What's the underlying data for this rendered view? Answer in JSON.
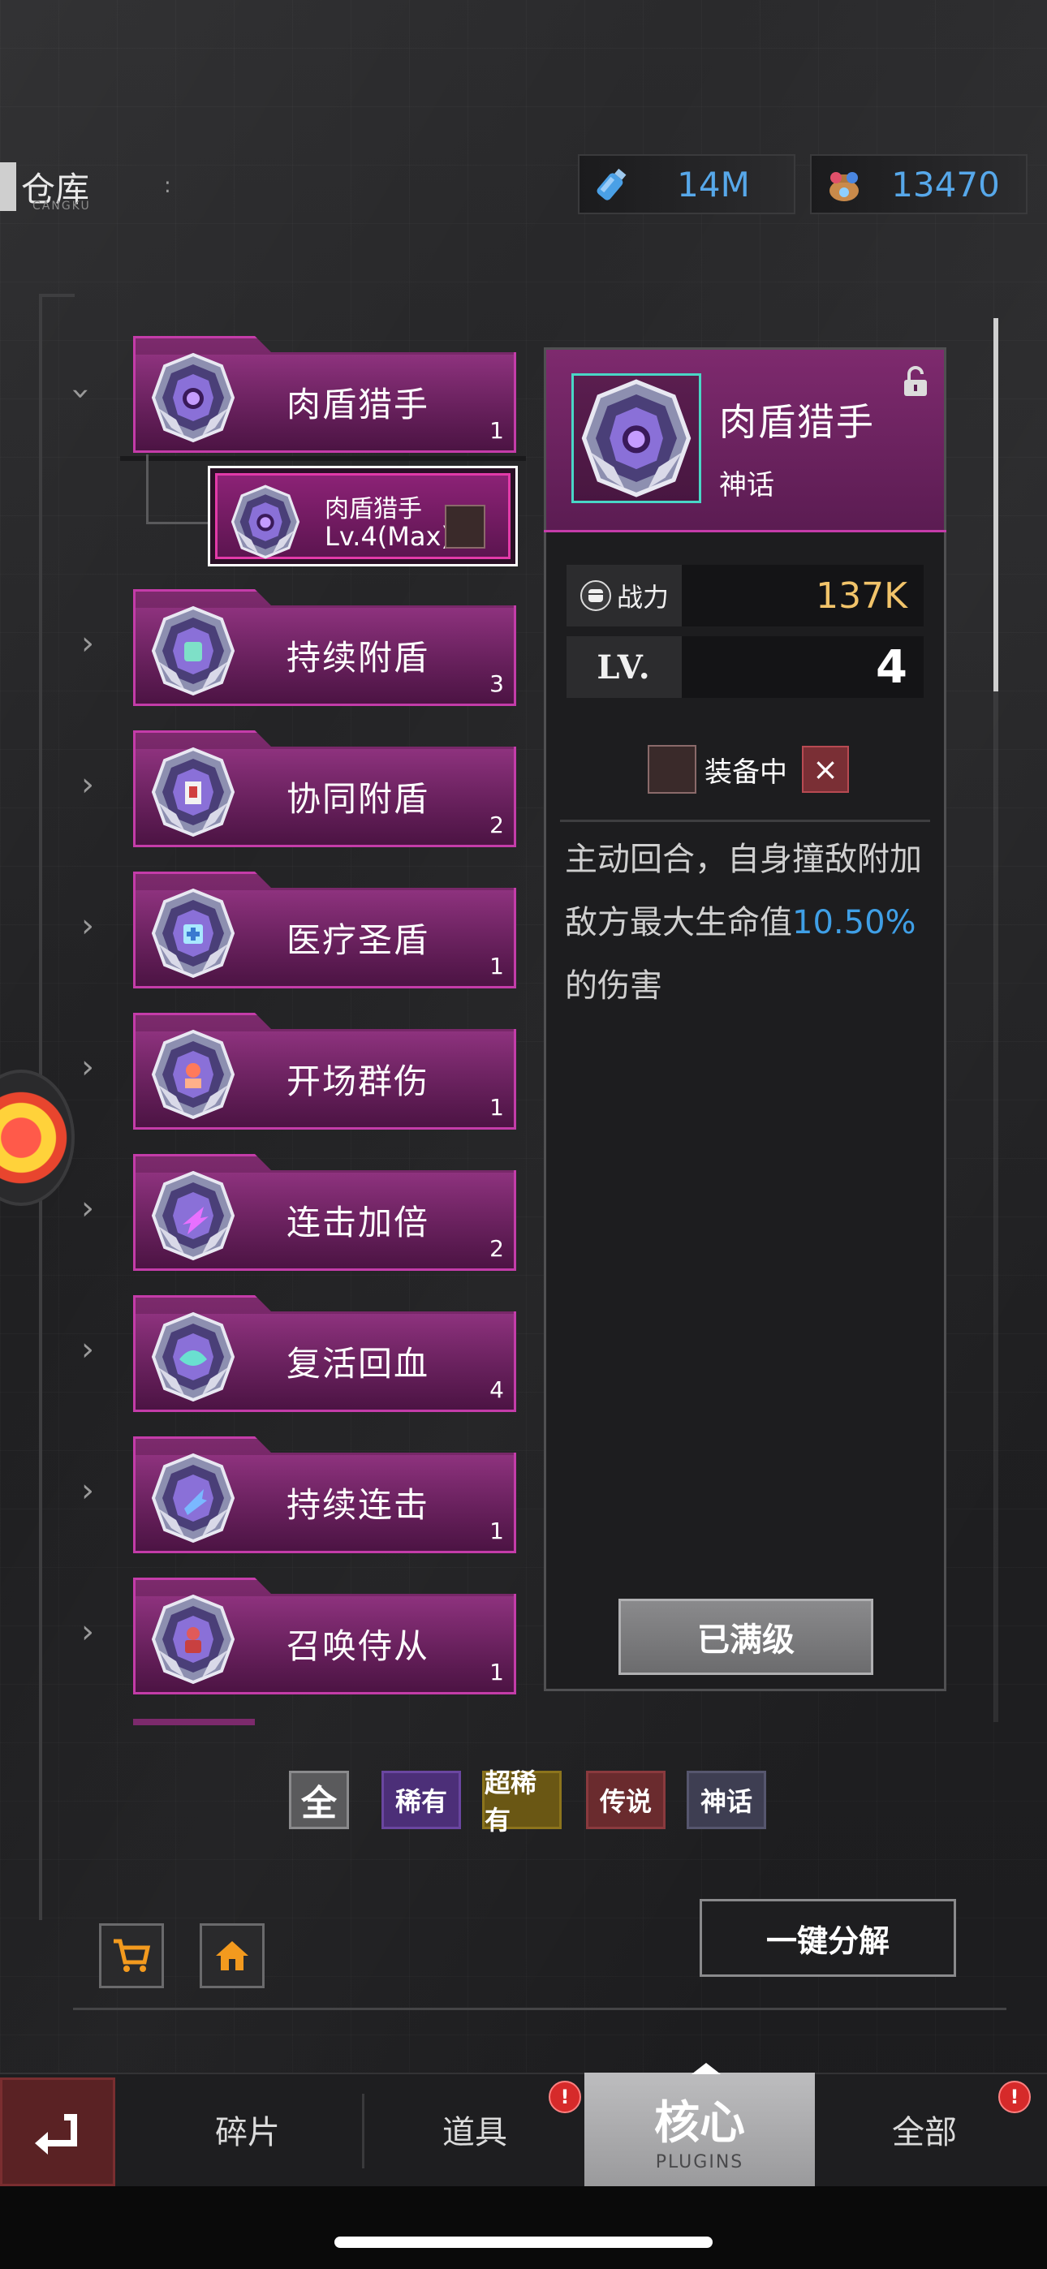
{
  "header": {
    "title": "仓库",
    "subtitle": "CANGKU",
    "separator": ":",
    "currency": [
      {
        "icon": "potion-bottle-icon",
        "value": "14M"
      },
      {
        "icon": "gem-bag-icon",
        "value": "13470"
      }
    ]
  },
  "categories": [
    {
      "name": "肉盾猎手",
      "count": "1",
      "expanded": true
    },
    {
      "name": "持续附盾",
      "count": "3"
    },
    {
      "name": "协同附盾",
      "count": "2"
    },
    {
      "name": "医疗圣盾",
      "count": "1"
    },
    {
      "name": "开场群伤",
      "count": "1"
    },
    {
      "name": "连击加倍",
      "count": "2"
    },
    {
      "name": "复活回血",
      "count": "4"
    },
    {
      "name": "持续连击",
      "count": "1"
    },
    {
      "name": "召唤侍从",
      "count": "1"
    }
  ],
  "selected_item": {
    "name": "肉盾猎手",
    "level": "Lv.4(Max)"
  },
  "detail": {
    "name": "肉盾猎手",
    "rarity": "神话",
    "power_label": "战力",
    "power_value": "137K",
    "level_label": "LV.",
    "level_value": "4",
    "equipped_label": "装备中",
    "close_symbol": "×",
    "desc_part1": "主动回合，自身撞敌附加敌方最大生命值",
    "desc_highlight": "10.50%",
    "desc_part2": "的伤害",
    "maxed_label": "已满级",
    "colors": {
      "highlight": "#3f9fe6",
      "power": "#f2c46a",
      "frame": "#c43ca9"
    }
  },
  "filters": {
    "all": "全",
    "rare": "稀有",
    "super_rare": "超稀有",
    "legend": "传说",
    "myth": "神话"
  },
  "actions": {
    "decompose": "一键分解",
    "shop_icon": "cart-icon",
    "home_icon": "home-icon"
  },
  "tabs": {
    "fragments": "碎片",
    "items": "道具",
    "core": "核心",
    "core_sub": "PLUGINS",
    "all": "全部",
    "alert_symbol": "!"
  }
}
